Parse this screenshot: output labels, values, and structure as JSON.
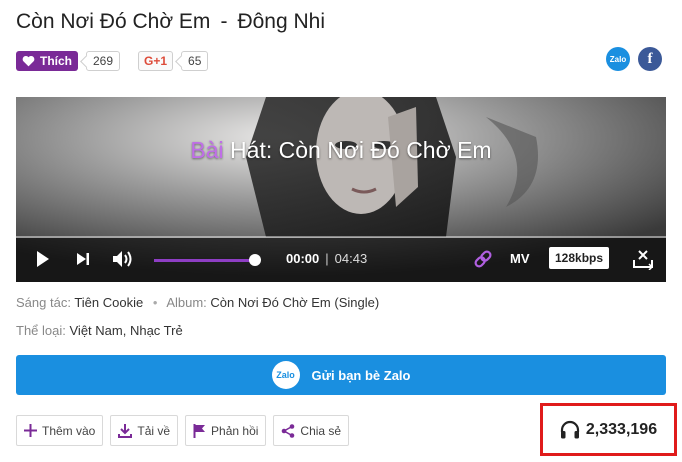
{
  "song": {
    "title": "Còn Nơi Đó Chờ Em",
    "separator": "-",
    "artist": "Đông Nhi"
  },
  "social": {
    "like_label": "Thích",
    "like_count": "269",
    "gplus_label": "G+1",
    "gplus_count": "65",
    "share_icons": [
      "Zalo",
      "f"
    ]
  },
  "player": {
    "lyric_highlight": "Bài",
    "lyric_rest": " Hát: Còn Nơi Đó Chờ Em",
    "current_time": "00:00",
    "time_divider": "|",
    "duration": "04:43",
    "mv_label": "MV",
    "quality": "128kbps",
    "volume_level": 0.95,
    "progress": 0.0,
    "accent_color": "#8e3ec4"
  },
  "meta": {
    "composer_label": "Sáng tác:",
    "composer": "Tiên Cookie",
    "dot": "•",
    "album_label": "Album:",
    "album": "Còn Nơi Đó Chờ Em (Single)",
    "genre_label": "Thể loại:",
    "genre": "Việt Nam, Nhạc Trẻ"
  },
  "zalo_button": {
    "logo": "Zalo",
    "label": "Gửi bạn bè Zalo",
    "color": "#1a8fe0"
  },
  "actions": {
    "add": "Thêm vào",
    "download": "Tải về",
    "feedback": "Phản hồi",
    "share": "Chia sẻ"
  },
  "listens": {
    "count": "2,333,196",
    "highlight_color": "#e01b1b"
  }
}
